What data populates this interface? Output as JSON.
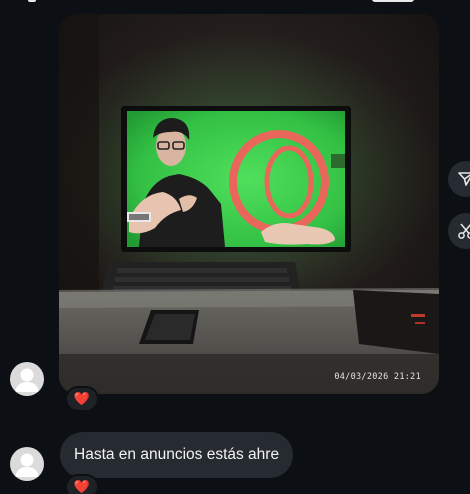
{
  "messages": [
    {
      "type": "image",
      "image_description_icon": "photo-of-monitor",
      "timestamp_overlay": "04/03/2026  21:21",
      "reaction": "❤️"
    },
    {
      "type": "text",
      "text": "Hasta en anuncios estás ahre",
      "reaction": "❤️"
    }
  ],
  "side_actions": [
    {
      "icon": "send-icon"
    },
    {
      "icon": "scissors-icon"
    }
  ],
  "colors": {
    "background": "#0c1014",
    "bubble": "#262b31",
    "accent_green": "#35c64a",
    "heart": "#ed2b42"
  }
}
